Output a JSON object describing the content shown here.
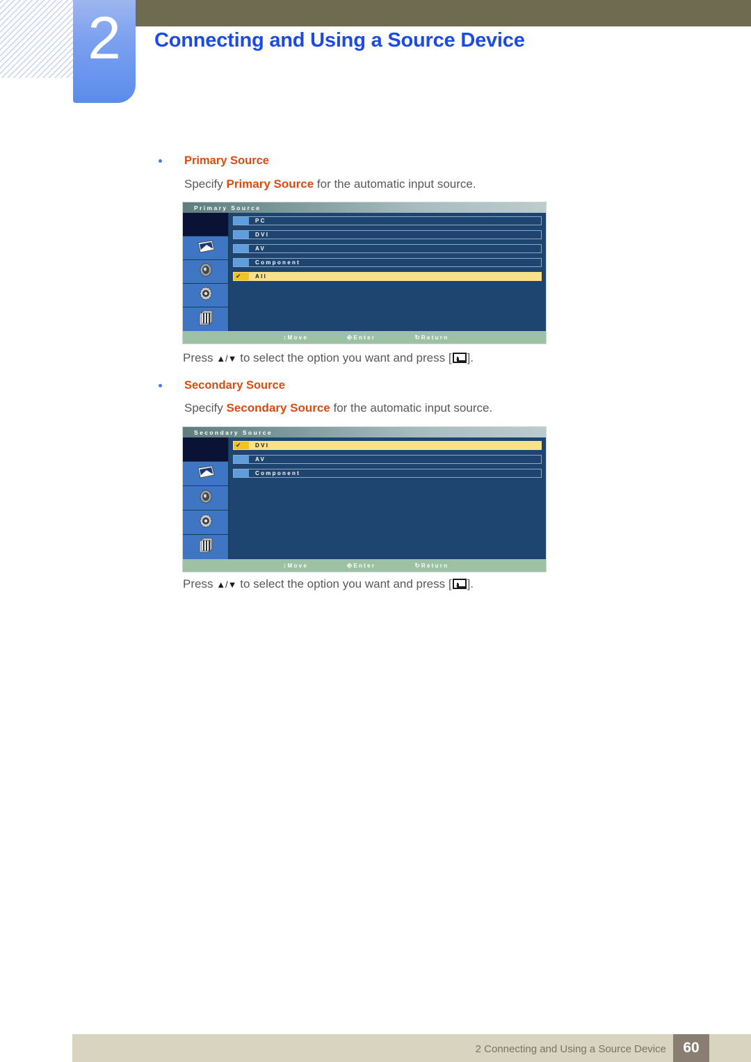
{
  "header": {
    "chapter_number": "2",
    "chapter_title": "Connecting and Using a Source Device"
  },
  "sections": [
    {
      "bullet_label": "Primary Source",
      "description_prefix": "Specify ",
      "description_highlight": "Primary Source",
      "description_suffix": " for the automatic input source.",
      "instruction_prefix": "Press ",
      "instruction_arrows": "▲/▼",
      "instruction_middle": " to select the option you want and press [",
      "instruction_suffix": "].",
      "osd": {
        "title": "Primary Source",
        "side_icons": [
          "blank",
          "picture-icon",
          "sound-icon",
          "setup-icon",
          "multi-control-icon"
        ],
        "rows": [
          {
            "label": "PC",
            "selected": false
          },
          {
            "label": "DVI",
            "selected": false
          },
          {
            "label": "AV",
            "selected": false
          },
          {
            "label": "Component",
            "selected": false
          },
          {
            "label": "All",
            "selected": true
          }
        ],
        "footer": [
          {
            "icon": "updown-arrow-icon",
            "label": "Move"
          },
          {
            "icon": "enter-icon",
            "label": "Enter"
          },
          {
            "icon": "return-icon",
            "label": "Return"
          }
        ]
      }
    },
    {
      "bullet_label": "Secondary Source",
      "description_prefix": "Specify ",
      "description_highlight": "Secondary Source",
      "description_suffix": " for the automatic input source.",
      "instruction_prefix": "Press ",
      "instruction_arrows": "▲/▼",
      "instruction_middle": " to select the option you want and press [",
      "instruction_suffix": "].",
      "osd": {
        "title": "Secondary Source",
        "side_icons": [
          "blank",
          "picture-icon",
          "sound-icon",
          "setup-icon",
          "multi-control-icon"
        ],
        "rows": [
          {
            "label": "DVI",
            "selected": true
          },
          {
            "label": "AV",
            "selected": false
          },
          {
            "label": "Component",
            "selected": false
          }
        ],
        "footer": [
          {
            "icon": "updown-arrow-icon",
            "label": "Move"
          },
          {
            "icon": "enter-icon",
            "label": "Enter"
          },
          {
            "icon": "return-icon",
            "label": "Return"
          }
        ]
      }
    }
  ],
  "footer": {
    "text": "2 Connecting and Using a Source Device",
    "page_number": "60"
  },
  "colors": {
    "chapter_title": "#1c4ae2",
    "chapter_tab": "#5b8cec",
    "header_bar": "#6e6b51",
    "highlight_orange": "#d94b10",
    "body_text": "#58585a",
    "osd_background": "#1e4470",
    "osd_selected": "#f7e18a",
    "osd_footer": "#9dc1a4",
    "footer_bar": "#d8d4c0",
    "footer_page_badge": "#8a7e72"
  }
}
